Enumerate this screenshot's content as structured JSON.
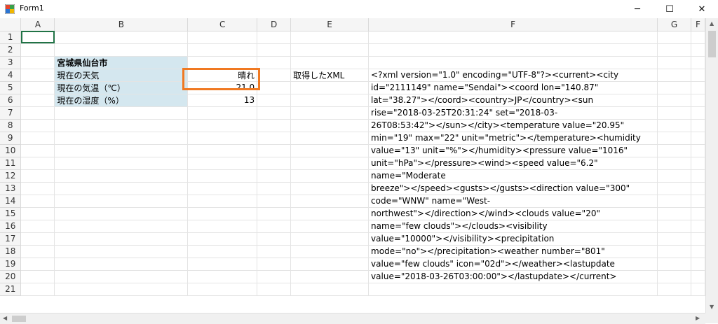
{
  "window": {
    "title": "Form1",
    "minimize_glyph": "─",
    "maximize_glyph": "☐",
    "close_glyph": "✕"
  },
  "columns": [
    "",
    "A",
    "B",
    "C",
    "D",
    "E",
    "F",
    "G",
    "F"
  ],
  "rows": [
    "1",
    "2",
    "3",
    "4",
    "5",
    "6",
    "7",
    "8",
    "9",
    "10",
    "11",
    "12",
    "13",
    "14",
    "15",
    "16",
    "17",
    "18",
    "19",
    "20",
    "21"
  ],
  "table": {
    "header": "宮城県仙台市",
    "weather_label": "現在の天気",
    "weather_value": "晴れ",
    "temp_label": "現在の気温（℃）",
    "temp_value": "21.0",
    "humidity_label": "現在の湿度（%）",
    "humidity_value": "13"
  },
  "xml_label": "取得したXML",
  "xml_lines": [
    "<?xml version=\"1.0\" encoding=\"UTF-8\"?><current><city",
    "id=\"2111149\" name=\"Sendai\"><coord lon=\"140.87\"",
    "lat=\"38.27\"></coord><country>JP</country><sun",
    "rise=\"2018-03-25T20:31:24\" set=\"2018-03-",
    "26T08:53:42\"></sun></city><temperature value=\"20.95\"",
    "min=\"19\" max=\"22\" unit=\"metric\"></temperature><humidity",
    "value=\"13\" unit=\"%\"></humidity><pressure value=\"1016\"",
    "unit=\"hPa\"></pressure><wind><speed value=\"6.2\"",
    "name=\"Moderate",
    "breeze\"></speed><gusts></gusts><direction value=\"300\"",
    "code=\"WNW\" name=\"West-",
    "northwest\"></direction></wind><clouds value=\"20\"",
    "name=\"few clouds\"></clouds><visibility",
    "value=\"10000\"></visibility><precipitation",
    "mode=\"no\"></precipitation><weather number=\"801\"",
    "value=\"few clouds\" icon=\"02d\"></weather><lastupdate",
    "value=\"2018-03-26T03:00:00\"></lastupdate></current>"
  ],
  "colors": {
    "label_fill": "#d4e7ef",
    "highlight": "#f07922",
    "selection": "#217346"
  }
}
